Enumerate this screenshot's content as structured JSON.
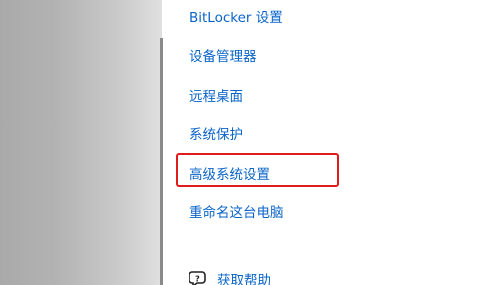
{
  "related_links": {
    "items": [
      {
        "label": "BitLocker 设置"
      },
      {
        "label": "设备管理器"
      },
      {
        "label": "远程桌面"
      },
      {
        "label": "系统保护"
      },
      {
        "label": "高级系统设置"
      },
      {
        "label": "重命名这台电脑"
      }
    ]
  },
  "help": {
    "label": "获取帮助",
    "icon": "help-chat-icon"
  },
  "colors": {
    "link": "#0a64c8",
    "highlight": "#e11b1b"
  }
}
